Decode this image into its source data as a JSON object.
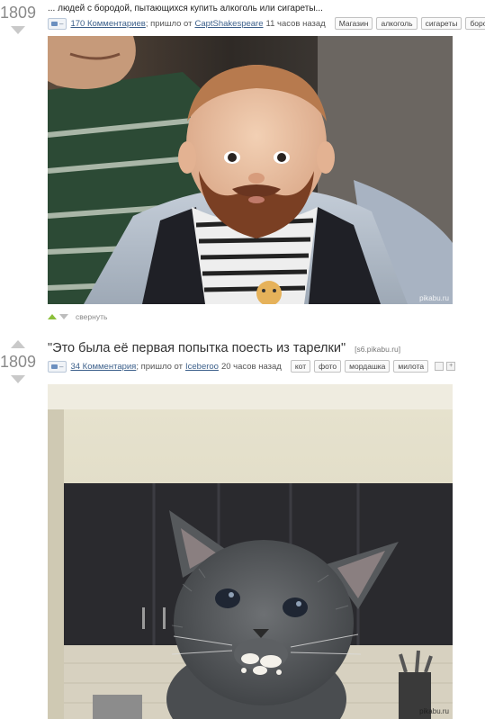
{
  "post1": {
    "rating": "1809",
    "description": "... людей с бородой, пытающихся купить алкоголь или сигареты...",
    "comments_badge": "–",
    "comments_label": "170 Комментариев",
    "via_text": "; пришло от",
    "author": "CaptShakespeare",
    "time": "11 часов назад",
    "tags": [
      "Магазин",
      "алкоголь",
      "сигареты",
      "борода"
    ],
    "watermark": "pikabu.ru",
    "collapse_label": "свернуть"
  },
  "post2": {
    "rating": "1809",
    "title": "\"Это была её первая попытка поесть из тарелки\"",
    "domain": "[s6.pikabu.ru]",
    "comments_badge": "–",
    "comments_label": "34 Комментария",
    "via_text": "; пришло от",
    "author": "Iceberoo",
    "time": "20 часов назад",
    "tags": [
      "кот",
      "фото",
      "мордашка",
      "милота"
    ],
    "watermark": "pikabu.ru"
  },
  "colors": {
    "link": "#3b5f8a",
    "vote_up": "#8bbf3a",
    "arrow": "#c9c9c9"
  }
}
